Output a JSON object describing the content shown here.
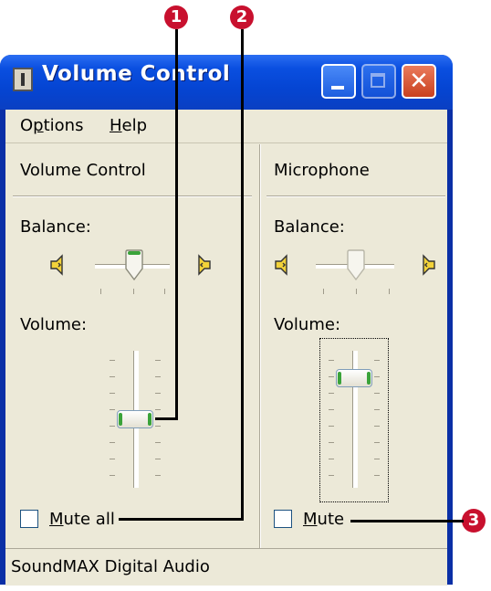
{
  "window": {
    "title": "Volume Control",
    "close_glyph": "✕"
  },
  "menu": {
    "options": {
      "prefix": "O",
      "access": "p",
      "suffix": "tions"
    },
    "help": {
      "access": "H",
      "suffix": "elp"
    }
  },
  "left_panel": {
    "heading": "Volume Control",
    "balance_label": "Balance:",
    "volume_label": "Volume:",
    "volume_level": 0.5,
    "mute_access": "M",
    "mute_suffix": "ute all",
    "mute_checked": false
  },
  "right_panel": {
    "heading": "Microphone",
    "balance_label": "Balance:",
    "volume_label": "Volume:",
    "volume_level": 0.85,
    "mute_access": "M",
    "mute_suffix": "ute",
    "mute_checked": false
  },
  "status": {
    "device": "SoundMAX Digital Audio"
  },
  "callouts": [
    "1",
    "2",
    "3"
  ],
  "colors": {
    "title_bar": "#0545d3",
    "close_button": "#c9401f",
    "callout": "#c8102e",
    "client_bg": "#ece9d8",
    "slider_grip": "#3aa33a"
  },
  "icons": {
    "app": "volume-control-app-icon",
    "speaker_left": "speaker-left-icon",
    "speaker_right": "speaker-right-icon"
  }
}
